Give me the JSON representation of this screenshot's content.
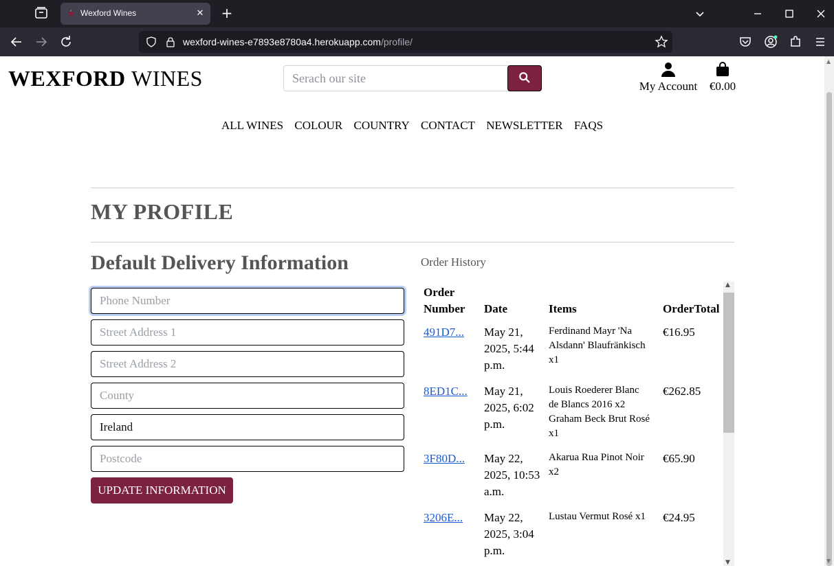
{
  "browser": {
    "tab_title": "Wexford Wines",
    "url_host": "wexford-wines-e7893e8780a4.herokuapp.com",
    "url_path": "/profile/"
  },
  "header": {
    "logo_bold": "WEXFORD",
    "logo_light": "WINES",
    "search_placeholder": "Serach our site",
    "account_label": "My Account",
    "bag_total": "€0.00"
  },
  "nav": {
    "items": [
      "ALL WINES",
      "COLOUR",
      "COUNTRY",
      "CONTACT",
      "NEWSLETTER",
      "FAQS"
    ]
  },
  "profile": {
    "title": "MY PROFILE",
    "form_title": "Default Delivery Information",
    "fields": {
      "phone": {
        "placeholder": "Phone Number",
        "value": ""
      },
      "street1": {
        "placeholder": "Street Address 1",
        "value": ""
      },
      "street2": {
        "placeholder": "Street Address 2",
        "value": ""
      },
      "county": {
        "placeholder": "County",
        "value": ""
      },
      "country": {
        "value": "Ireland"
      },
      "postcode": {
        "placeholder": "Postcode",
        "value": ""
      }
    },
    "update_label": "UPDATE INFORMATION"
  },
  "orders": {
    "title": "Order History",
    "headers": {
      "number_line1": "Order",
      "number_line2": "Number",
      "date": "Date",
      "items": "Items",
      "total": "OrderTotal"
    },
    "rows": [
      {
        "number": "491D7...",
        "date_l1": "May 21,",
        "date_l2": "2025, 5:44",
        "date_l3": "p.m.",
        "items_l1": "Ferdinand Mayr 'Na",
        "items_l2": "Alsdann' Blaufränkisch",
        "items_l3": "x1",
        "items_l4": "",
        "total": "€16.95"
      },
      {
        "number": "8ED1C...",
        "date_l1": "May 21,",
        "date_l2": "2025, 6:02",
        "date_l3": "p.m.",
        "items_l1": "Louis Roederer Blanc",
        "items_l2": "de Blancs 2016 x2",
        "items_l3": "Graham Beck Brut Rosé",
        "items_l4": "x1",
        "total": "€262.85"
      },
      {
        "number": "3F80D...",
        "date_l1": "May 22,",
        "date_l2": "2025, 10:53",
        "date_l3": "a.m.",
        "items_l1": "Akarua Rua Pinot Noir",
        "items_l2": "x2",
        "items_l3": "",
        "items_l4": "",
        "total": "€65.90"
      },
      {
        "number": "3206E...",
        "date_l1": "May 22,",
        "date_l2": "2025, 3:04",
        "date_l3": "p.m.",
        "items_l1": "Lustau Vermut Rosé x1",
        "items_l2": "",
        "items_l3": "",
        "items_l4": "",
        "total": "€24.95"
      }
    ]
  },
  "colors": {
    "brand": "#7d2140",
    "link": "#1a5bd6"
  }
}
